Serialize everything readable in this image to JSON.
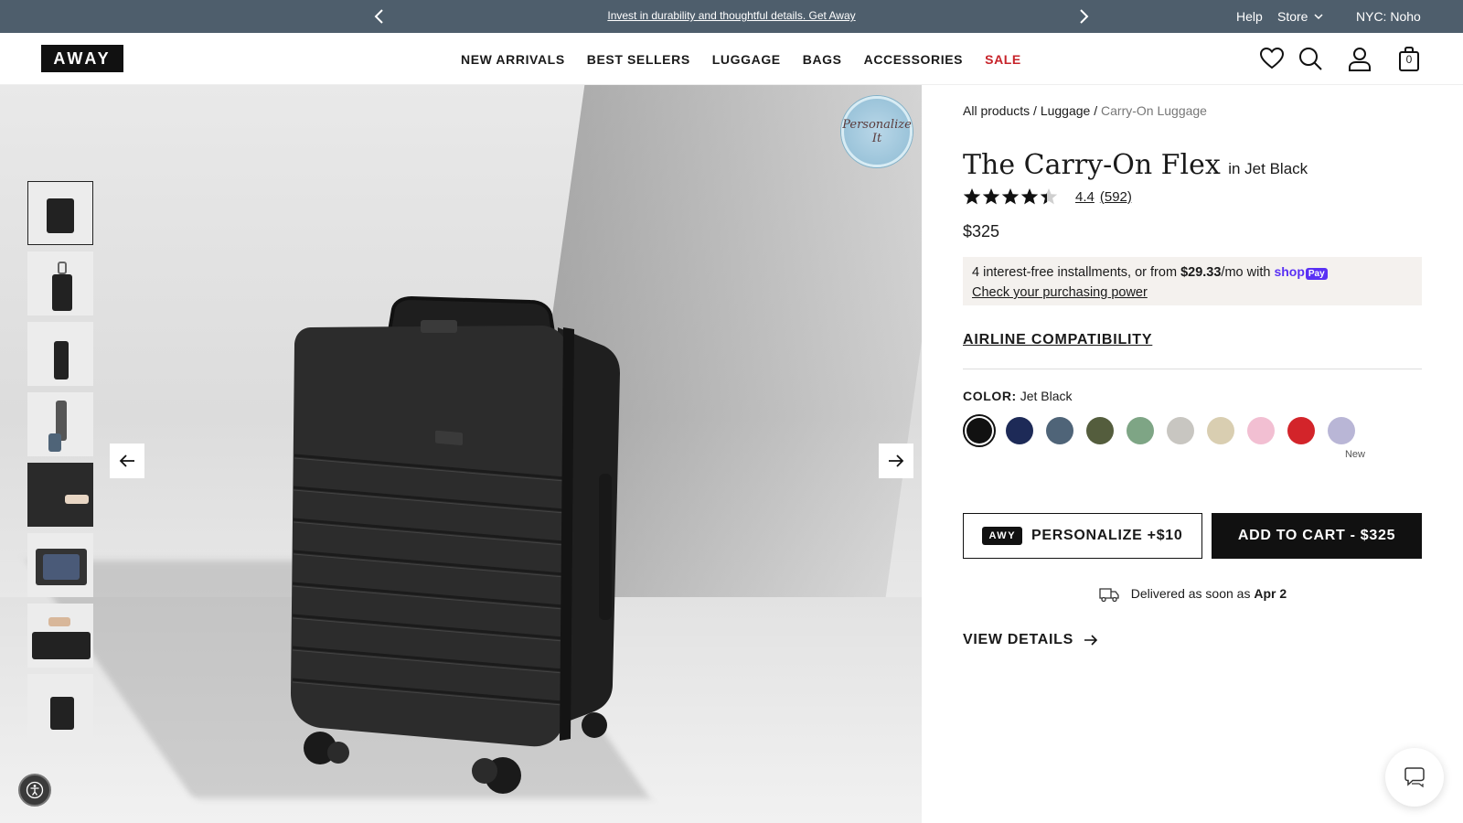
{
  "announcement": {
    "message": "Invest in durability and thoughtful details. Get Away",
    "help": "Help",
    "store": "Store",
    "location": "NYC: Noho"
  },
  "header": {
    "logo": "AWAY",
    "nav": [
      "NEW ARRIVALS",
      "BEST SELLERS",
      "LUGGAGE",
      "BAGS",
      "ACCESSORIES",
      "SALE"
    ],
    "cart_count": "0"
  },
  "gallery": {
    "badge_line1": "Personalize",
    "badge_line2": "It",
    "thumbnail_count": 8
  },
  "product": {
    "breadcrumb": [
      "All products /",
      "Luggage /",
      "Carry-On Luggage"
    ],
    "name": "The Carry-On Flex",
    "color_suffix": "in Jet Black",
    "rating": "4.4",
    "rating_value": 4.4,
    "reviews": "(592)",
    "price": "$325",
    "installments": {
      "prefix": "4 interest-free installments, or from ",
      "amount": "$29.33",
      "suffix": "/mo with ",
      "brand": "shop",
      "brand_tag": "Pay",
      "link": "Check your purchasing power"
    },
    "airline": "AIRLINE COMPATIBILITY",
    "color_label": "COLOR:",
    "color_value": "Jet Black",
    "swatches": [
      "#111111",
      "#1d2a57",
      "#4f6478",
      "#545d3d",
      "#7ea585",
      "#c8c6c1",
      "#d9ceb1",
      "#f2bfd2",
      "#d3242a",
      "#b9b6d6"
    ],
    "new_label": "New",
    "personalize_tag": "AWY",
    "personalize_label": "PERSONALIZE +$10",
    "cart_label": "ADD TO CART - $325",
    "delivery_prefix": "Delivered as soon as ",
    "delivery_date": "Apr 2",
    "view_details": "VIEW DETAILS"
  }
}
